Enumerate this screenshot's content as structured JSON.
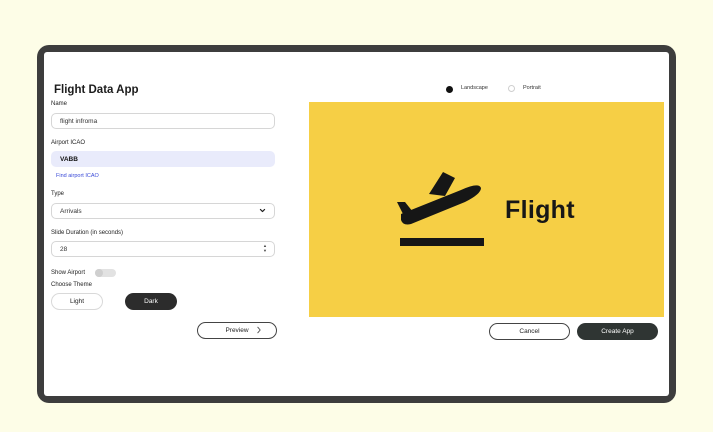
{
  "app": {
    "title": "Flight Data App"
  },
  "form": {
    "name": {
      "label": "Name",
      "value": "flight infroma"
    },
    "icao": {
      "label": "Airport ICAO",
      "value": "VABB",
      "link": "Find airport ICAO"
    },
    "type": {
      "label": "Type",
      "value": "Arrivals"
    },
    "duration": {
      "label": "Slide Duration (in seconds)",
      "value": "28"
    },
    "show_airport": {
      "label": "Show Airport",
      "on": false
    },
    "theme": {
      "label": "Choose Theme",
      "light": "Light",
      "dark": "Dark",
      "selected": "Dark"
    },
    "preview_button": "Preview"
  },
  "orientation": {
    "landscape": "Landscape",
    "portrait": "Portrait",
    "selected": "Landscape"
  },
  "preview": {
    "brand": "Flight",
    "background": "#f6cf45",
    "icon": "airplane-takeoff-icon"
  },
  "actions": {
    "cancel": "Cancel",
    "create": "Create App"
  },
  "colors": {
    "accent_dark": "#2c2c2c",
    "link": "#3b4bd8",
    "frame": "#3d3d3d",
    "page_bg": "#fdfde7"
  }
}
